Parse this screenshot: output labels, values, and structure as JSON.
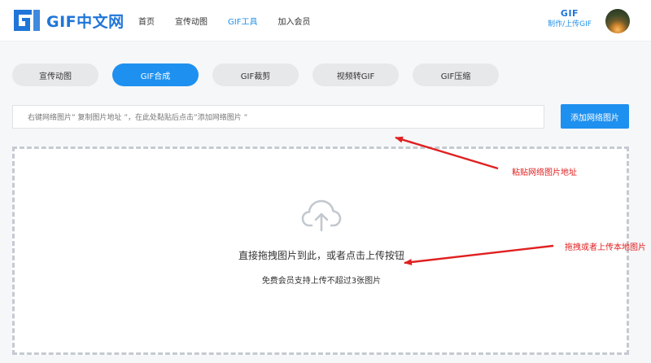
{
  "header": {
    "logo_text": "GIF中文网",
    "nav": [
      {
        "label": "首页",
        "active": false
      },
      {
        "label": "宣传动图",
        "active": false
      },
      {
        "label": "GIF工具",
        "active": true
      },
      {
        "label": "加入会员",
        "active": false
      }
    ],
    "brand_title": "GIF",
    "brand_sub": "制作/上传GIF"
  },
  "tabs": [
    {
      "label": "宣传动图",
      "active": false
    },
    {
      "label": "GIF合成",
      "active": true
    },
    {
      "label": "GIF裁剪",
      "active": false
    },
    {
      "label": "视频转GIF",
      "active": false
    },
    {
      "label": "GIF压缩",
      "active": false
    }
  ],
  "url_row": {
    "placeholder": "右键网络图片” 复制图片地址 ”，在此处黏贴后点击”添加网络图片 ”",
    "add_button": "添加网络图片"
  },
  "dropzone": {
    "icon": "cloud-upload-icon",
    "main_text": "直接拖拽图片到此，或者点击上传按钮",
    "sub_text": "免费会员支持上传不超过3张图片"
  },
  "annotations": {
    "paste_label": "粘贴网络图片地址",
    "drag_label": "拖拽或者上传本地图片",
    "color": "#e02020"
  },
  "colors": {
    "accent": "#1e90ef",
    "brand": "#1f75d8"
  }
}
